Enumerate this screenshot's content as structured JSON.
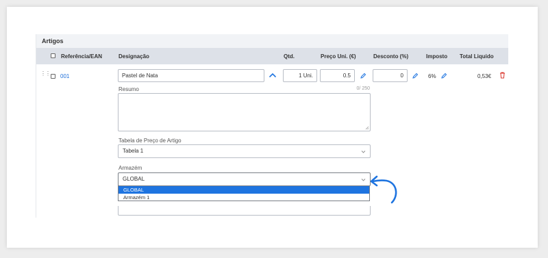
{
  "section": {
    "title": "Artigos"
  },
  "table": {
    "headers": {
      "reference": "Referência/EAN",
      "designation": "Designação",
      "qty": "Qtd.",
      "unit_price": "Preço Uni. (€)",
      "discount": "Desconto (%)",
      "tax": "Imposto",
      "total": "Total Liquido"
    }
  },
  "row": {
    "reference": "001",
    "designation": "Pastel de Nata",
    "qty": "1 Uni.",
    "unit_price": "0.5",
    "discount": "0",
    "tax": "6%",
    "total": "0,53€"
  },
  "summary": {
    "label": "Resumo",
    "counter": "0/ 250"
  },
  "price_table": {
    "label": "Tabela de Preço de Artigo",
    "value": "Tabela 1"
  },
  "warehouse": {
    "label": "Armazém",
    "value": "GLOBAL",
    "options": [
      "GLOBAL",
      "Armazém 1"
    ],
    "selected_index": 0
  },
  "colors": {
    "accent": "#1e74e0",
    "header_bg": "#dde1e8",
    "delete": "#d9342b"
  }
}
